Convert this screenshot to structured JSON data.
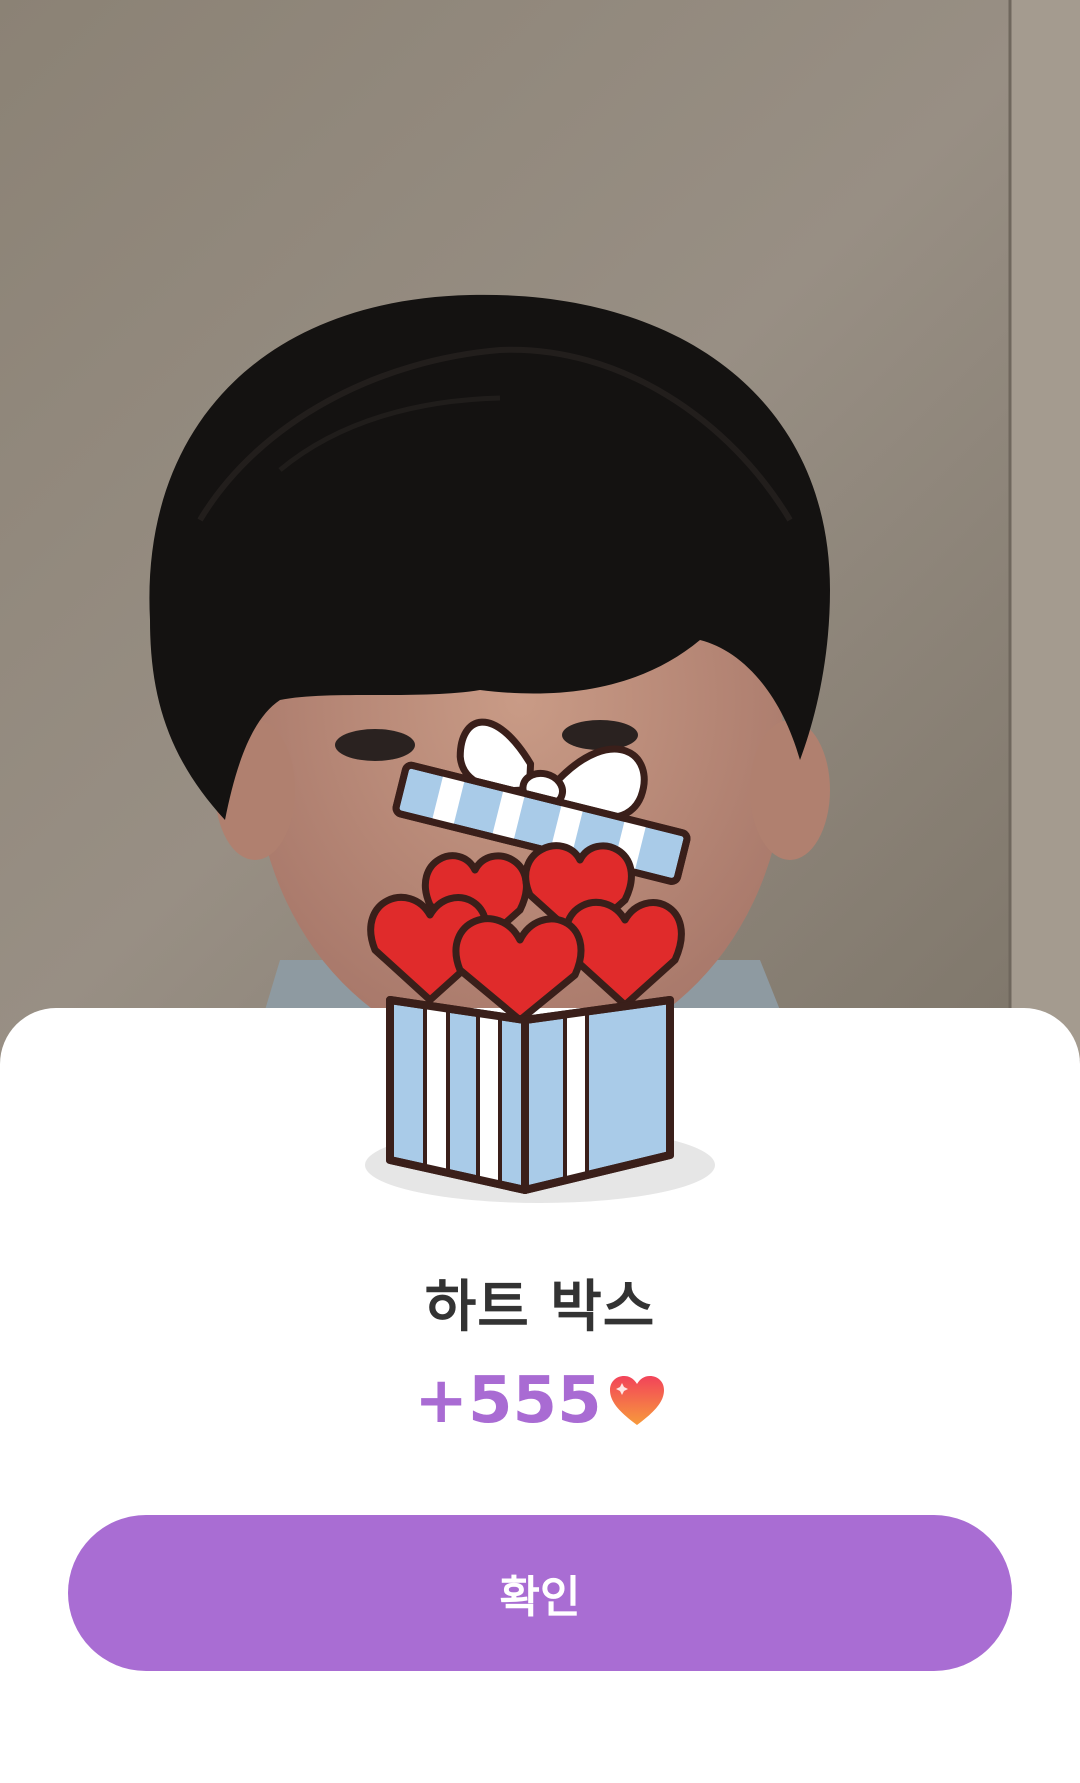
{
  "reward_dialog": {
    "title": "하트 박스",
    "amount": "+555",
    "currency_icon": "heart-icon",
    "gift_icon": "gift-box-hearts-icon",
    "confirm_label": "확인"
  },
  "colors": {
    "accent": "#a96dd3",
    "amount_text": "#a96bd3",
    "title_text": "#333333",
    "sheet_bg": "#ffffff"
  }
}
